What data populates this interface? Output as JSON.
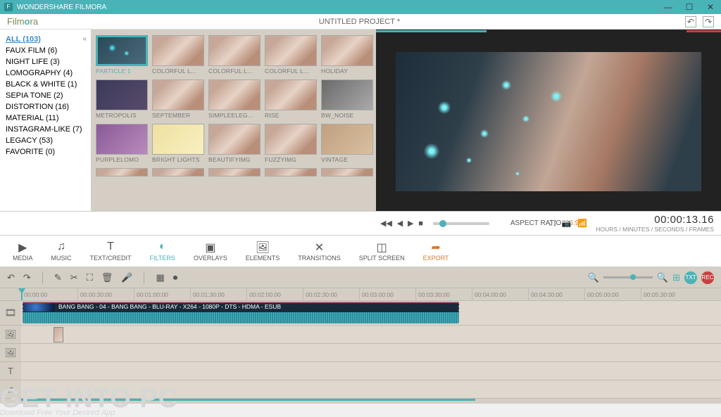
{
  "titlebar": {
    "app_name": "WONDERSHARE FILMORA",
    "icon_letter": "F"
  },
  "chrome": {
    "logo": "Filmora",
    "project_title": "UNTITLED PROJECT *",
    "btn_undo": "↶",
    "btn_redo": "↷"
  },
  "sidebar": {
    "categories": [
      {
        "label": "ALL (103)",
        "active": true
      },
      {
        "label": "FAUX FILM (6)"
      },
      {
        "label": "NIGHT LIFE (3)"
      },
      {
        "label": "LOMOGRAPHY (4)"
      },
      {
        "label": "BLACK & WHITE (1)"
      },
      {
        "label": "SEPIA TONE (2)"
      },
      {
        "label": "DISTORTION (16)"
      },
      {
        "label": "MATERIAL (11)"
      },
      {
        "label": "INSTAGRAM-LIKE (7)"
      },
      {
        "label": "LEGACY (53)"
      },
      {
        "label": "FAVORITE (0)"
      }
    ],
    "collapse": "«"
  },
  "filters": {
    "rows": [
      [
        "PARTICLE 1",
        "COLORFUL L...",
        "COLORFUL L...",
        "COLORFUL L...",
        "HOLIDAY"
      ],
      [
        "METROPOLIS",
        "SEPTEMBER",
        "SIMPLEELEG...",
        "RISE",
        "BW_NOISE"
      ],
      [
        "PURPLELOMO",
        "BRIGHT LIGHTS",
        "BEAUTIFYIMG",
        "FUZZYIMG",
        "VINTAGE"
      ]
    ],
    "selected": "PARTICLE 1"
  },
  "preview_ctrl": {
    "buttons": {
      "prev": "◀◀",
      "rev": "◀",
      "play": "▶",
      "stop": "■"
    },
    "aspect_label": "ASPECT RATIO:",
    "aspect_value": "16:9",
    "timecode": "00:00:13.16",
    "tc_label": "HOURS / MINUTES / SECONDS / FRAMES",
    "icons": {
      "fullscreen": "⛶",
      "camera": "📷",
      "signal": "📶"
    }
  },
  "tabs": [
    {
      "icon": "▶",
      "label": "MEDIA"
    },
    {
      "icon": "♫",
      "label": "MUSIC"
    },
    {
      "icon": "T",
      "label": "TEXT/CREDIT"
    },
    {
      "icon": "◐",
      "label": "FILTERS",
      "active": true
    },
    {
      "icon": "▣",
      "label": "OVERLAYS"
    },
    {
      "icon": "🖼",
      "label": "ELEMENTS"
    },
    {
      "icon": "✕",
      "label": "TRANSITIONS"
    },
    {
      "icon": "◫",
      "label": "SPLIT SCREEN"
    },
    {
      "icon": "➦",
      "label": "EXPORT",
      "export": true
    }
  ],
  "tl_toolbar": {
    "undo": "↶",
    "redo": "↷",
    "edit": "✎",
    "cut": "✂",
    "crop": "⛶",
    "trash": "🗑",
    "mic": "🎤",
    "grid": "▦",
    "rec": "⏺",
    "zoom_out": "🔍",
    "zoom_in": "🔍",
    "fit": "⊞",
    "badge1": "TXT",
    "badge2": "REC"
  },
  "ruler": [
    "00:00:00",
    "00:00:30:00",
    "00:01:00:00",
    "00:01:30:00",
    "00:02:00:00",
    "00:02:30:00",
    "00:03:00:00",
    "00:03:30:00",
    "00:04:00:00",
    "00:04:30:00",
    "00:05:00:00",
    "00:05:30:00"
  ],
  "clip": {
    "label": "BANG BANG - 04 - BANG BANG - BLU-RAY - X264 - 1080P - DTS - HDMA - ESUB"
  },
  "track_icons": {
    "video": "🎞",
    "image": "🖼",
    "pip": "🖼",
    "text": "T",
    "audio": "♫"
  },
  "watermark": {
    "main": "GET INTO PC",
    "sub": "Download Free Your Desired App"
  }
}
